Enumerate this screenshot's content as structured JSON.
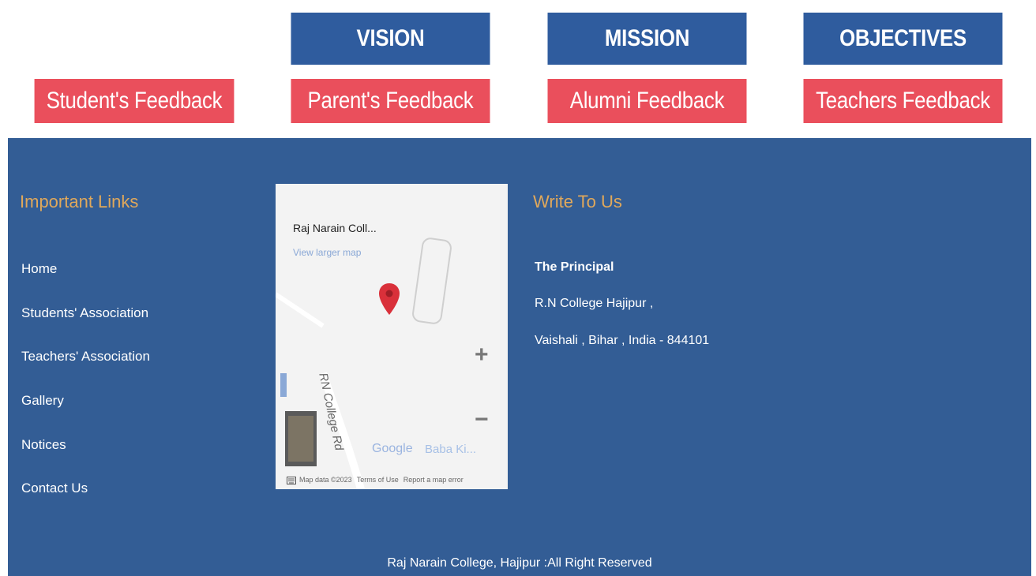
{
  "top_buttons": {
    "vision": "VISION",
    "mission": "MISSION",
    "objectives": "OBJECTIVES"
  },
  "feedback_buttons": {
    "student": "Student's Feedback",
    "parent": "Parent's Feedback",
    "alumni": "Alumni Feedback",
    "teachers": "Teachers Feedback"
  },
  "colors": {
    "blue_button": "#2f5c9e",
    "red_button": "#ea4f5c",
    "footer_bg": "#335d95",
    "heading": "#e0a85b"
  },
  "footer": {
    "important_links": {
      "heading": "Important Links",
      "items": [
        "Home",
        "Students' Association",
        "Teachers' Association",
        "Gallery",
        "Notices",
        "Contact Us"
      ]
    },
    "map": {
      "place_title": "Raj Narain Coll...",
      "view_larger": "View larger map",
      "road_label": "RN College Rd",
      "google_logo": "Google",
      "nearby_place": "Baba Ki...",
      "zoom_in": "+",
      "zoom_out": "−",
      "map_data": "Map data ©2023",
      "terms": "Terms of Use",
      "report": "Report a map error",
      "icons": [
        "map-pin-icon",
        "keyboard-icon"
      ]
    },
    "write_to_us": {
      "heading": "Write To Us",
      "recipient": "The Principal",
      "address_line1": "R.N College Hajipur ,",
      "address_line2": "Vaishali , Bihar , India - 844101"
    },
    "copyright": "Raj Narain College, Hajipur :All Right Reserved"
  }
}
